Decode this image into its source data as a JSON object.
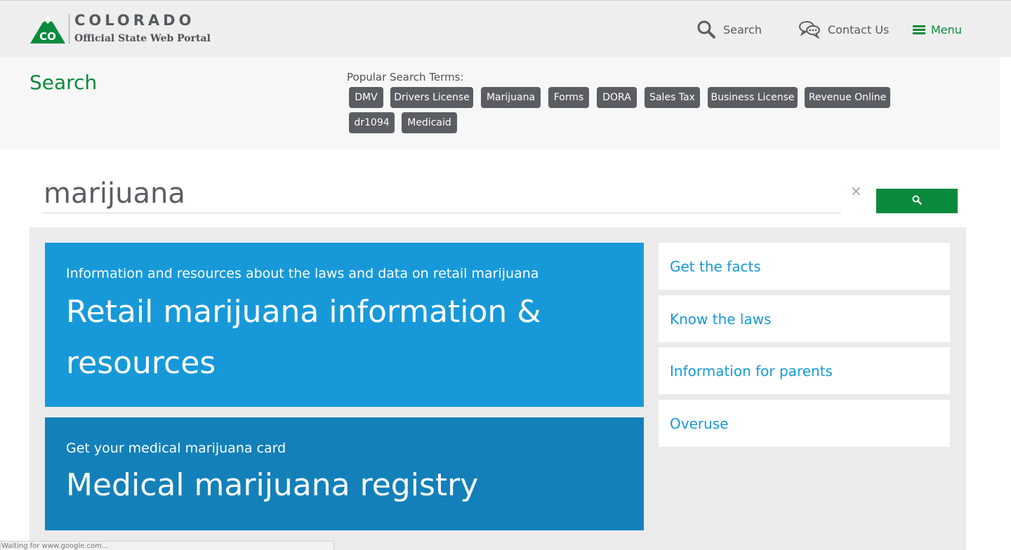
{
  "header": {
    "brand_name": "COLORADO",
    "brand_sub": "Official State Web Portal",
    "logo_text": "CO",
    "nav": {
      "search": "Search",
      "contact": "Contact Us",
      "menu": "Menu"
    }
  },
  "search_section": {
    "title": "Search",
    "popular_label": "Popular Search Terms:",
    "tags": [
      "DMV",
      "Drivers License",
      "Marijuana",
      "Forms",
      "DORA",
      "Sales Tax",
      "Business License",
      "Revenue Online",
      "dr1094",
      "Medicaid"
    ]
  },
  "search": {
    "query": "marijuana",
    "clear_icon": "×"
  },
  "results": {
    "cards": [
      {
        "subtitle": "Information and resources about the laws and data on retail marijuana",
        "title": "Retail marijuana information & resources"
      },
      {
        "subtitle": "Get your medical marijuana card",
        "title": "Medical marijuana registry"
      }
    ],
    "links": [
      "Get the facts",
      "Know the laws",
      "Information for parents",
      "Overuse"
    ]
  },
  "status_bar": {
    "text": "Waiting for www.google.com..."
  },
  "colors": {
    "brand_green": "#0a8a3c",
    "card_blue": "#1799d9",
    "card_dark_blue": "#1380ba",
    "tag_gray": "#5a5e63"
  }
}
